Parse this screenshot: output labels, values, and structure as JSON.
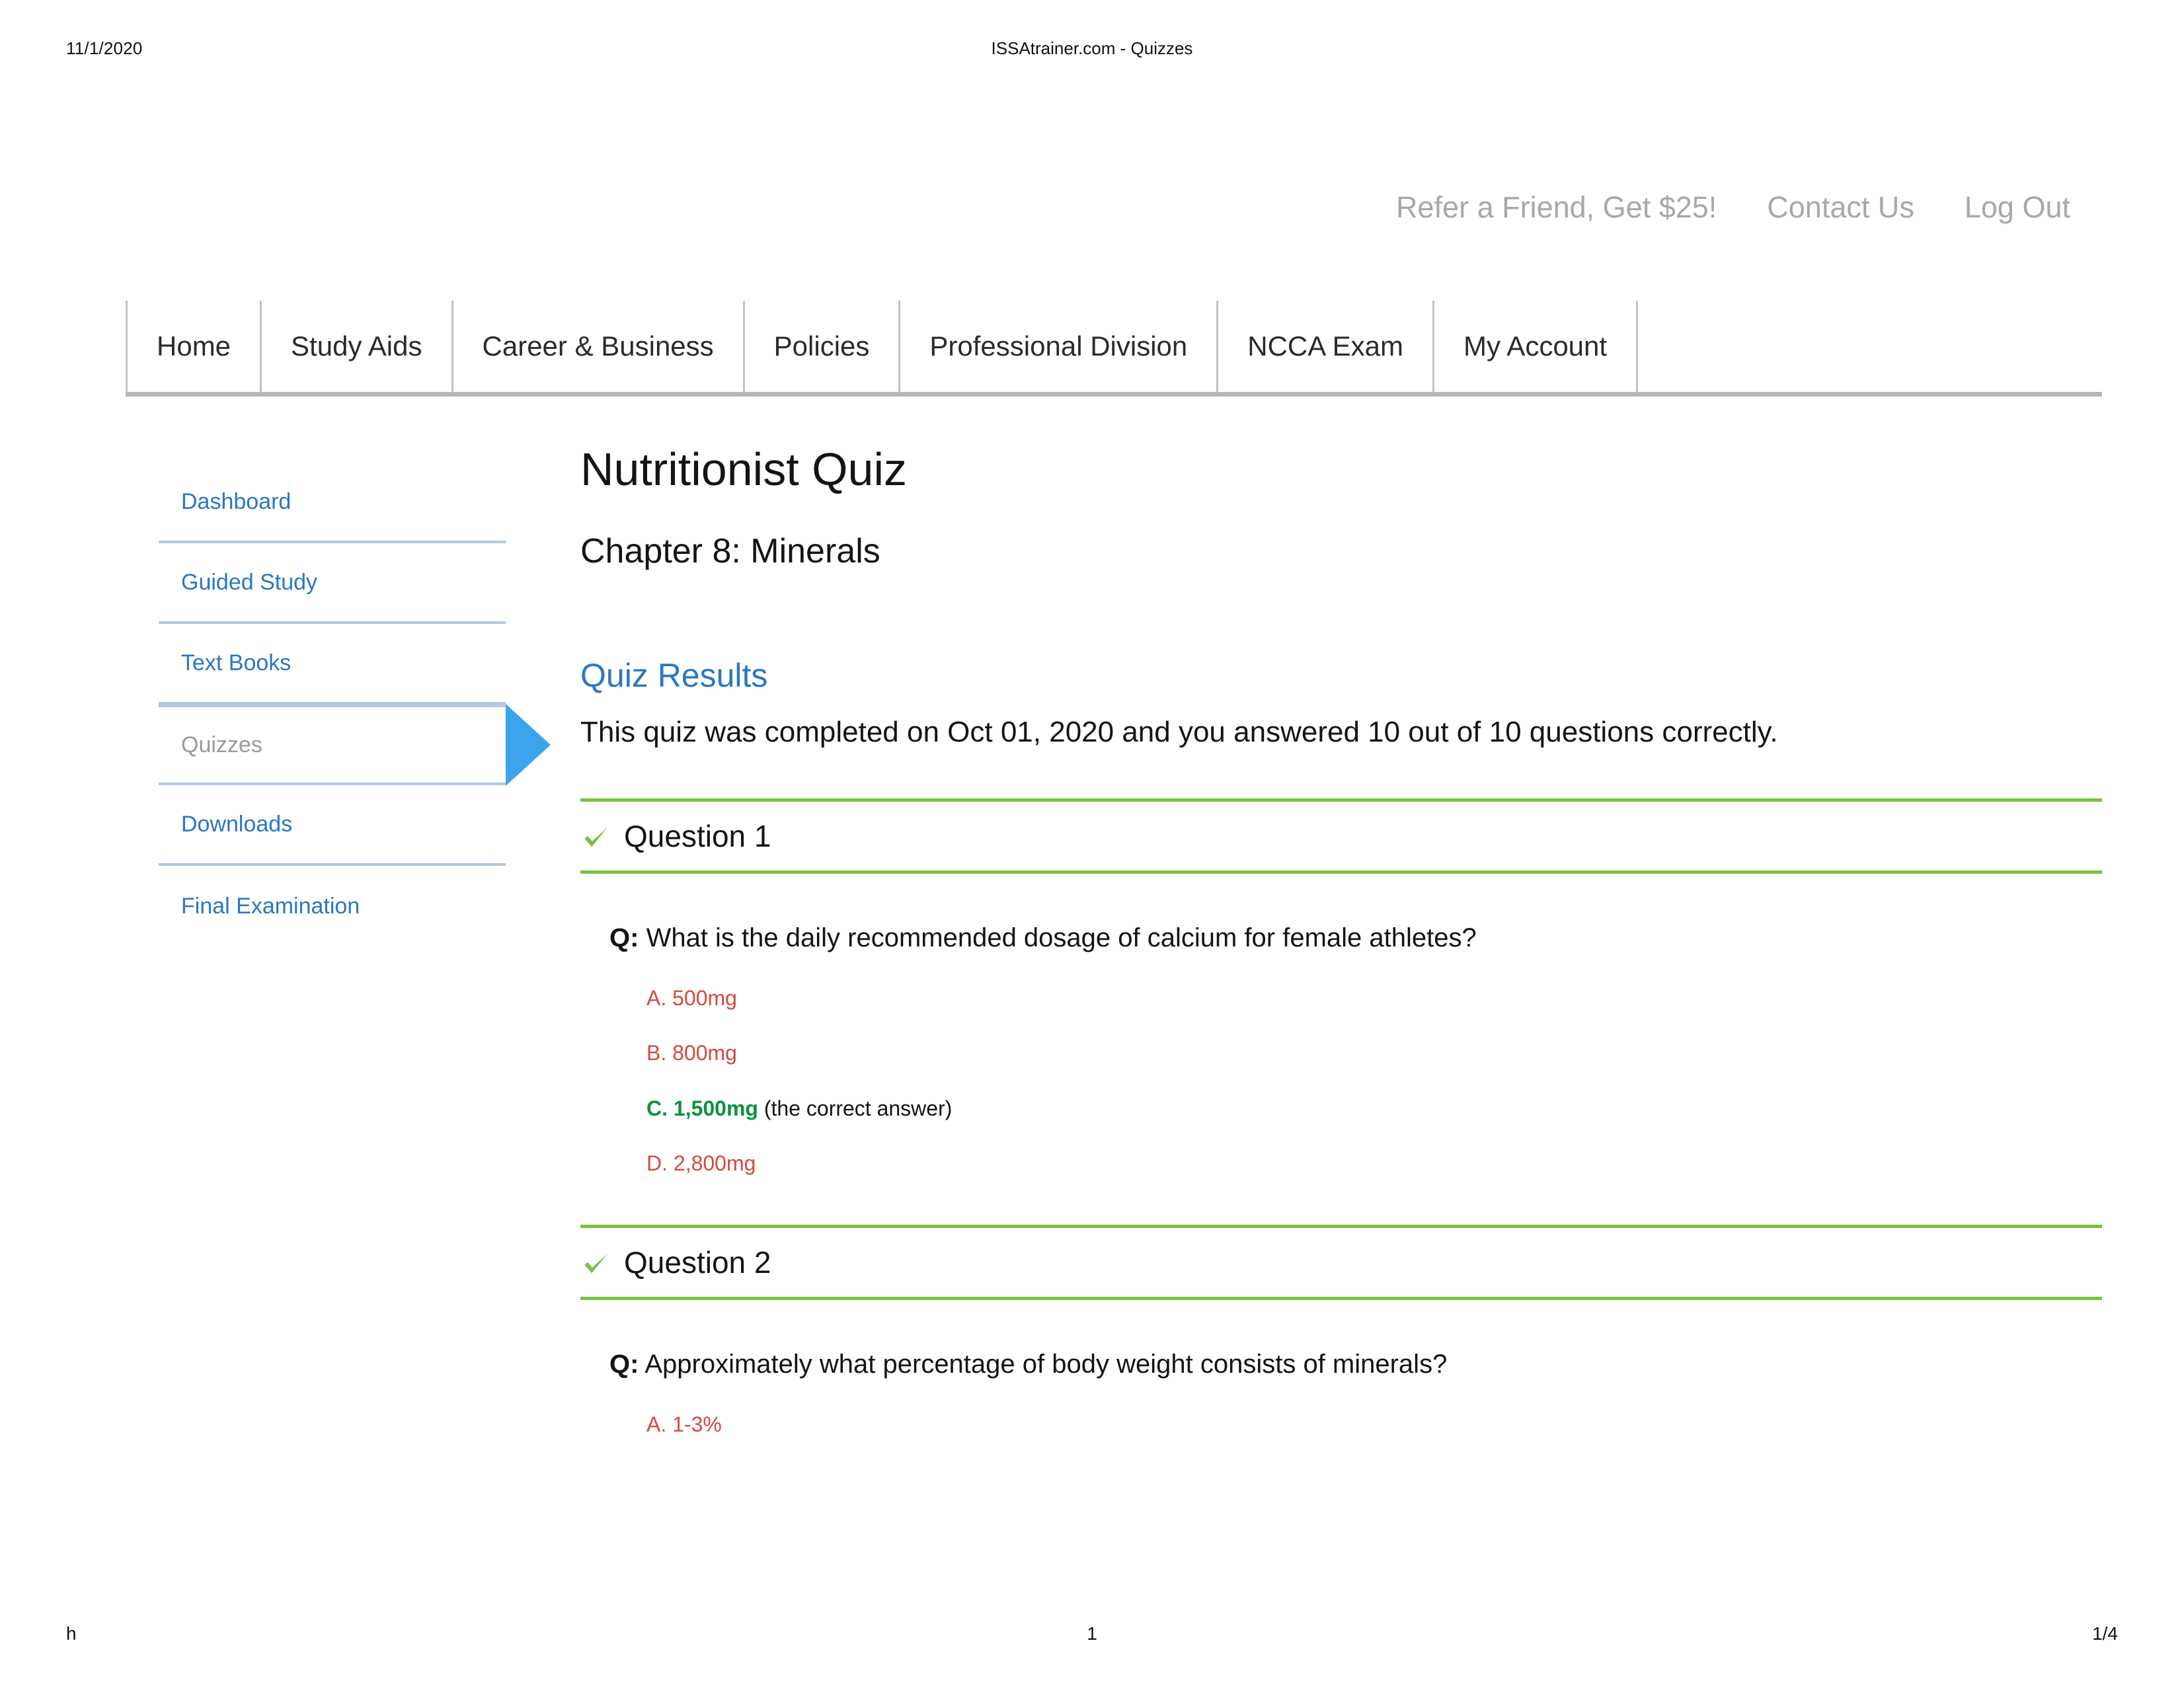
{
  "print": {
    "date": "11/1/2020",
    "title": "ISSAtrainer.com - Quizzes",
    "footer_left": "h",
    "footer_center": "1",
    "footer_right": "1/4"
  },
  "utility_links": [
    {
      "label": "Refer a Friend, Get $25!"
    },
    {
      "label": "Contact Us"
    },
    {
      "label": "Log Out"
    }
  ],
  "nav": [
    {
      "label": "Home"
    },
    {
      "label": "Study Aids"
    },
    {
      "label": "Career & Business"
    },
    {
      "label": "Policies"
    },
    {
      "label": "Professional Division"
    },
    {
      "label": "NCCA Exam"
    },
    {
      "label": "My Account"
    }
  ],
  "sidebar": [
    {
      "label": "Dashboard",
      "active": false
    },
    {
      "label": "Guided Study",
      "active": false
    },
    {
      "label": "Text Books",
      "active": false
    },
    {
      "label": "Quizzes",
      "active": true
    },
    {
      "label": "Downloads",
      "active": false
    },
    {
      "label": "Final Examination",
      "active": false
    }
  ],
  "main": {
    "page_title": "Nutritionist Quiz",
    "chapter_title": "Chapter 8: Minerals",
    "results_heading": "Quiz Results",
    "results_text": "This quiz was completed on Oct 01, 2020 and you answered 10 out of 10 questions correctly.",
    "q_prefix": "Q:"
  },
  "questions": [
    {
      "label": "Question 1",
      "status_icon": "check-icon",
      "prompt": "What is the daily recommended dosage of calcium for female athletes?",
      "answers": [
        {
          "text": "A. 500mg",
          "correct": false,
          "note": ""
        },
        {
          "text": "B. 800mg",
          "correct": false,
          "note": ""
        },
        {
          "text": "C. 1,500mg",
          "correct": true,
          "note": "(the correct answer)"
        },
        {
          "text": "D. 2,800mg",
          "correct": false,
          "note": ""
        }
      ]
    },
    {
      "label": "Question 2",
      "status_icon": "check-icon",
      "prompt": "Approximately what percentage of body weight consists of minerals?",
      "answers": [
        {
          "text": "A. 1-3%",
          "correct": false,
          "note": ""
        }
      ]
    }
  ],
  "colors": {
    "link_blue": "#2a77c4",
    "arrow_blue": "#3ba4ef",
    "divider_blue": "#b5c7e0",
    "green_rule": "#7ac143",
    "correct_green": "#0d9140",
    "incorrect_red": "#d24a43",
    "util_gray": "#a8a8a8",
    "nav_border": "#b6b6b6"
  }
}
